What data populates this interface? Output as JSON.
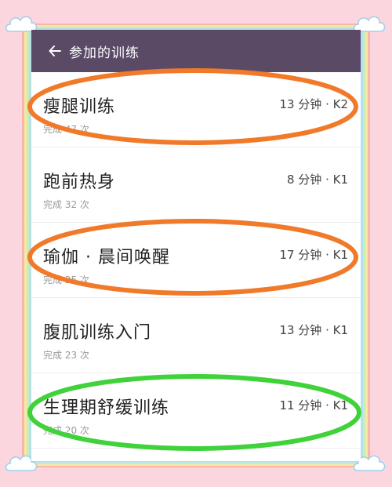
{
  "header": {
    "title": "参加的训练",
    "back_icon": "arrow-left-icon"
  },
  "workouts": [
    {
      "title": "瘦腿训练",
      "meta": "13 分钟 · K2",
      "completed": "完成 47 次"
    },
    {
      "title": "跑前热身",
      "meta": "8 分钟 · K1",
      "completed": "完成 32 次"
    },
    {
      "title": "瑜伽 · 晨间唤醒",
      "meta": "17 分钟 · K1",
      "completed": "完成 25 次"
    },
    {
      "title": "腹肌训练入门",
      "meta": "13 分钟 · K1",
      "completed": "完成 23 次"
    },
    {
      "title": "生理期舒缓训练",
      "meta": "11 分钟 · K1",
      "completed": "完成 20 次"
    }
  ],
  "colors": {
    "app_bar": "#5a4a66",
    "highlight_orange": "#f07a2a",
    "highlight_green": "#3fd23a",
    "frame_pink": "#fbd6de"
  }
}
